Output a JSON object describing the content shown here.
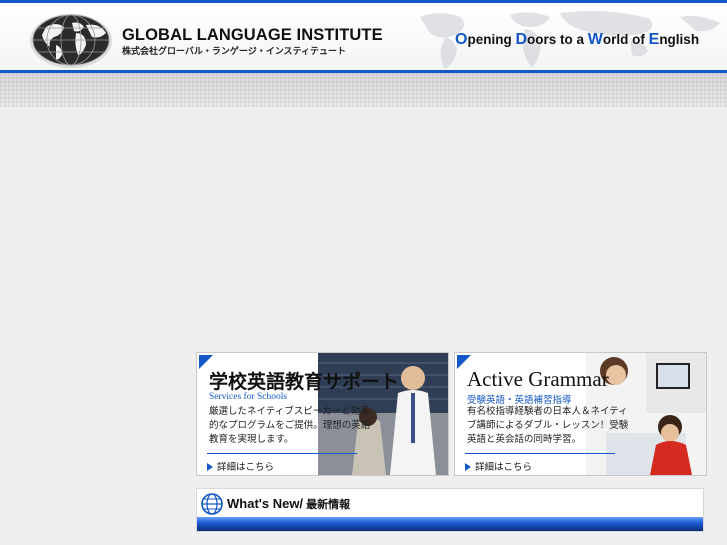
{
  "header": {
    "logo_en": "GLOBAL LANGUAGE INSTITUTE",
    "logo_jp": "株式会社グローバル・ランゲージ・インスティテュート",
    "tagline_parts": [
      "O",
      "pening ",
      "D",
      "oors to a ",
      "W",
      "orld of ",
      "E",
      "nglish"
    ],
    "accent_color": "#1457c7"
  },
  "banners": [
    {
      "title": "学校英語教育サポート",
      "subtitle": "Services for Schools",
      "desc": "厳選したネイティブスピーカーと効果的なプログラムをご提供。理想の英語教育を実現します。",
      "more": "詳細はこちら",
      "icon": "classroom-photo"
    },
    {
      "title": "Active Grammar",
      "subtitle": "受験英語・英語補習指導",
      "desc": "有名校指導経験者の日本人＆ネイティブ講師によるダブル・レッスン！受験英語と英会話の同時学習。",
      "more": "詳細はこちら",
      "icon": "tutoring-photo"
    }
  ],
  "news": {
    "label_en": "What's New/",
    "label_jp": " 最新情報",
    "icon": "globe-icon"
  }
}
